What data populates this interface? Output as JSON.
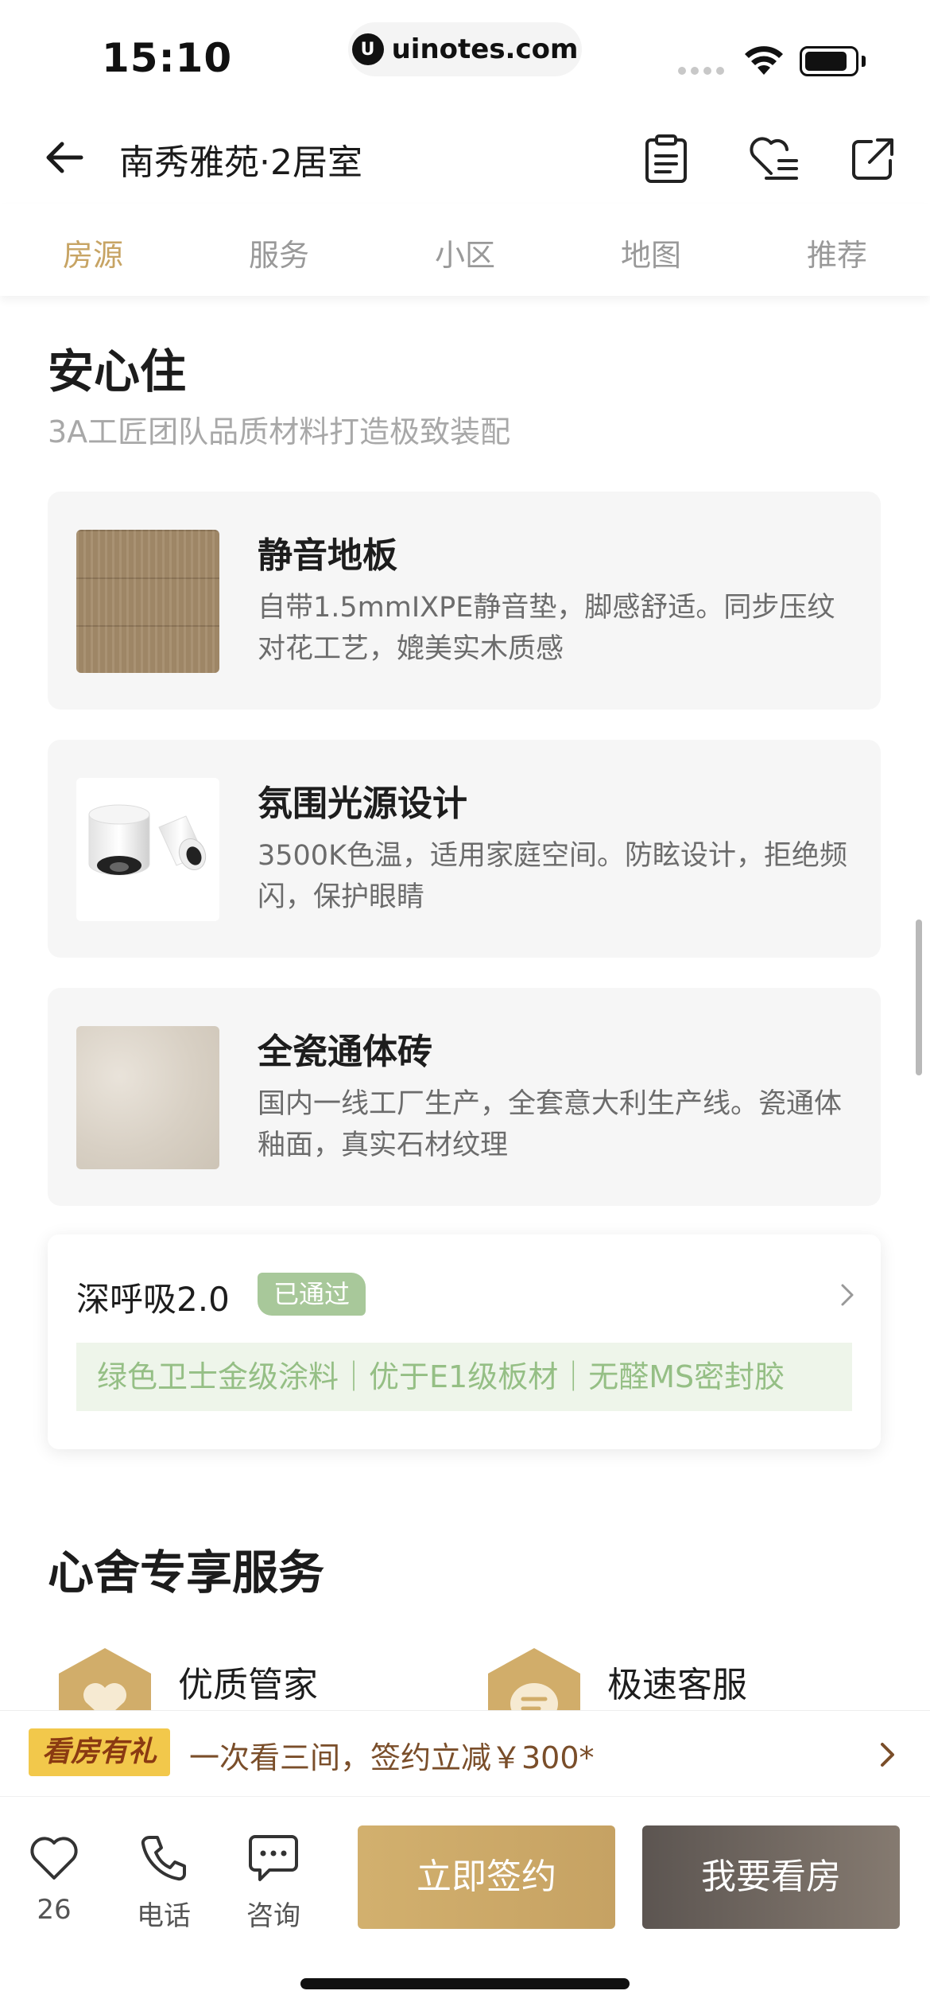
{
  "status_bar": {
    "time": "15:10",
    "url_logo": "U",
    "url": "uinotes.com"
  },
  "nav": {
    "title": "南秀雅苑·2居室"
  },
  "tabs": [
    {
      "label": "房源",
      "active": true
    },
    {
      "label": "服务",
      "active": false
    },
    {
      "label": "小区",
      "active": false
    },
    {
      "label": "地图",
      "active": false
    },
    {
      "label": "推荐",
      "active": false
    }
  ],
  "section": {
    "title": "安心住",
    "subtitle": "3A工匠团队品质材料打造极致装配"
  },
  "features": [
    {
      "title": "静音地板",
      "desc": "自带1.5mmIXPE静音垫，脚感舒适。同步压纹对花工艺，媲美实木质感",
      "image": "wood-floor"
    },
    {
      "title": "氛围光源设计",
      "desc": "3500K色温，适用家庭空间。防眩设计，拒绝频闪，保护眼睛",
      "image": "spotlights"
    },
    {
      "title": "全瓷通体砖",
      "desc": "国内一线工厂生产，全套意大利生产线。瓷通体釉面，真实石材纹理",
      "image": "tile"
    }
  ],
  "deep_breath": {
    "title": "深呼吸2.0",
    "badge": "已通过",
    "tags": "绿色卫士金级涂料｜优于E1级板材｜无醛MS密封胶"
  },
  "services": {
    "title": "心舍专享服务",
    "items": [
      {
        "label": "优质管家",
        "icon": "heart-icon"
      },
      {
        "label": "极速客服",
        "icon": "chat-icon"
      }
    ]
  },
  "promo": {
    "tag": "看房有礼",
    "text": "一次看三间，签约立减￥300*"
  },
  "bottom_bar": {
    "favorite_count": "26",
    "phone_label": "电话",
    "consult_label": "咨询",
    "sign_label": "立即签约",
    "view_label": "我要看房"
  },
  "colors": {
    "accent": "#c7a464",
    "badge_green": "#a8c89a",
    "tag_green": "#95bf85",
    "promo_yellow": "#f2c84b"
  }
}
